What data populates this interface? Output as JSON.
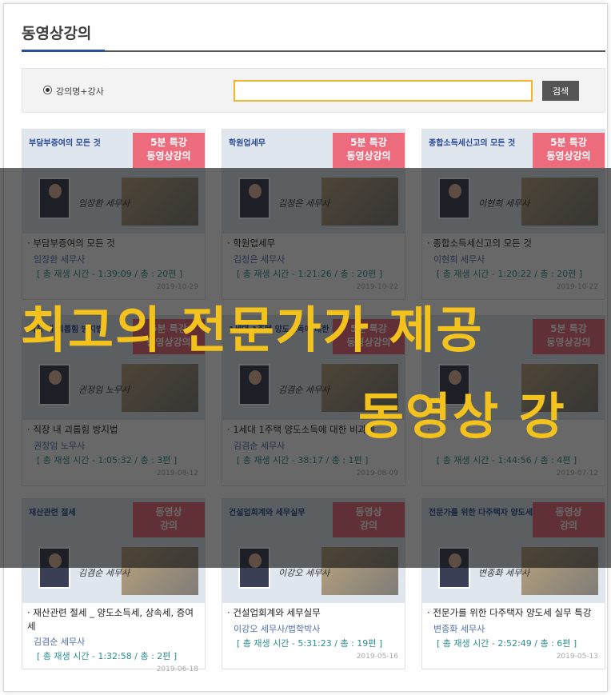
{
  "page_title": "동영상강의",
  "search": {
    "radio_label": "강의명+강사",
    "value": "",
    "button": "검색"
  },
  "overlay": {
    "line1": "최고의 전문가가 제공",
    "line2": "동영상 강"
  },
  "badge_text": "5분 특강\n동영상강의",
  "badge_text_alt": "동영상\n강의",
  "courses": [
    {
      "thumb_title": "부담부증여의 모든 것",
      "signature": "임장환 세무사",
      "title": "부담부증여의 모든 것",
      "author": "임장환 세무사",
      "meta": "[ 총 재생 시간 - 1:39:09 / 총 : 20편 ]",
      "date": "2019-10-29"
    },
    {
      "thumb_title": "학원업세무",
      "signature": "김정은 세무사",
      "title": "학원업세무",
      "author": "김정은 세무사",
      "meta": "[ 총 재생 시간 - 1:21:26 / 총 : 20편 ]",
      "date": "2019-10-22"
    },
    {
      "thumb_title": "종합소득세신고의 모든 것",
      "signature": "이현희 세무사",
      "title": "종합소득세신고의 모든 것",
      "author": "이현희 세무사",
      "meta": "[ 총 재생 시간 - 1:20:22 / 총 : 20편 ]",
      "date": "2019-10-22"
    },
    {
      "thumb_title": "직장 내 괴롭힘 방지법",
      "signature": "권정임 노무사",
      "title": "직장 내 괴롭힘 방지법",
      "author": "권정임 노무사",
      "meta": "[ 총 재생 시간 - 1:05:32 / 총 : 3편 ]",
      "date": "2019-08-12"
    },
    {
      "thumb_title": "1세대 1주택 양도소득에 대한 비과세",
      "signature": "김겸순 세무사",
      "title": "1세대 1주택 양도소득에 대한 비과세",
      "author": "김겸순 세무사",
      "meta": "[ 총 재생 시간 - 38:17 / 총 : 1편 ]",
      "date": "2019-08-09"
    },
    {
      "thumb_title": "",
      "signature": "",
      "title": "",
      "author": "",
      "meta": "[ 총 재생 시간 - 1:44:56 / 총 : 4편 ]",
      "date": "2019-07-12"
    },
    {
      "thumb_title": "재산관련 절세",
      "signature": "김겸순 세무사",
      "title": "재산관련 절세 _ 양도소득세, 상속세, 증여세",
      "author": "김겸순 세무사",
      "meta": "[ 총 재생 시간 - 1:32:58 / 총 : 2편 ]",
      "date": "2019-06-18"
    },
    {
      "thumb_title": "건설업회계와 세무실무",
      "signature": "이강오 세무사",
      "title": "건설업회계와 세무실무",
      "author": "이강오 세무사/법학박사",
      "meta": "[ 총 재생 시간 - 5:31:23 / 총 : 19편 ]",
      "date": "2019-05-16"
    },
    {
      "thumb_title": "전문가를 위한 다주택자 양도세 실무 특강",
      "signature": "변종화 세무사",
      "title": "전문가를 위한 다주택자 양도세 실무 특강",
      "author": "변종화 세무사",
      "meta": "[ 총 재생 시간 - 2:52:49 / 총 : 6편 ]",
      "date": "2019-05-13"
    }
  ]
}
